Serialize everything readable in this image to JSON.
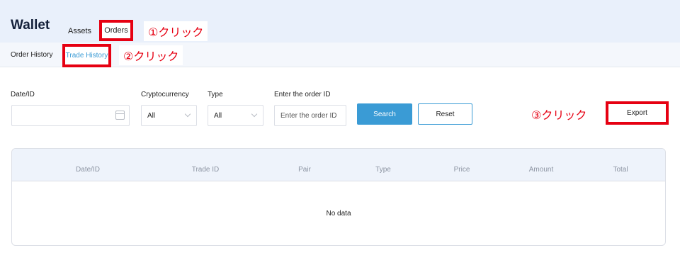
{
  "header": {
    "title": "Wallet",
    "tabs": [
      {
        "label": "Assets"
      },
      {
        "label": "Orders"
      }
    ]
  },
  "subnav": {
    "items": [
      {
        "label": "Order History"
      },
      {
        "label": "Trade History"
      }
    ]
  },
  "annotations": {
    "step1": "①クリック",
    "step2": "②クリック",
    "step3": "③クリック"
  },
  "filters": {
    "date_label": "Date/ID",
    "date_value": "",
    "crypto_label": "Cryptocurrency",
    "crypto_value": "All",
    "type_label": "Type",
    "type_value": "All",
    "order_id_label": "Enter the order ID",
    "order_id_placeholder": "Enter the order ID",
    "order_id_value": ""
  },
  "buttons": {
    "search": "Search",
    "reset": "Reset",
    "export": "Export"
  },
  "table": {
    "columns": [
      "Date/ID",
      "Trade ID",
      "Pair",
      "Type",
      "Price",
      "Amount",
      "Total"
    ],
    "empty_text": "No data"
  },
  "colors": {
    "accent": "#3a9bd5",
    "highlight": "#e60012",
    "header_bg": "#e9f0fb"
  }
}
